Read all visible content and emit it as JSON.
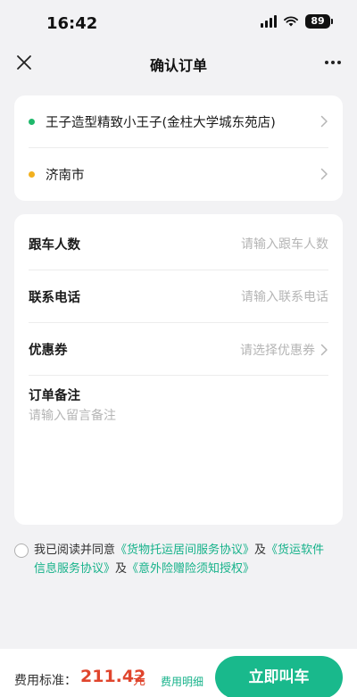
{
  "status_bar": {
    "time": "16:42",
    "battery": "89"
  },
  "nav": {
    "title": "确认订单"
  },
  "route": {
    "origin": {
      "name": "王子造型精致小王子(金柱大学城东苑店)",
      "color": "#1fb86b"
    },
    "destination": {
      "name": "济南市",
      "color": "#f2b01e"
    }
  },
  "form": {
    "passengers": {
      "label": "跟车人数",
      "placeholder": "请输入跟车人数"
    },
    "phone": {
      "label": "联系电话",
      "placeholder": "请输入联系电话"
    },
    "coupon": {
      "label": "优惠券",
      "placeholder": "请选择优惠券"
    },
    "note": {
      "label": "订单备注",
      "placeholder": "请输入留言备注"
    }
  },
  "agreement": {
    "prefix": "我已阅读并同意",
    "link1": "《货物托运居间服务协议》",
    "and1": "及",
    "link2": "《货运软件信息服务协议》",
    "and2": "及",
    "link3": "《意外险赠险须知授权》"
  },
  "footer": {
    "fee_label": "费用标准：",
    "fee_amount": "211.42",
    "fee_unit": "元",
    "fee_detail": "费用明细",
    "call_button": "立即叫车"
  },
  "colors": {
    "accent": "#19b98c",
    "price": "#e0452d",
    "link": "#16b28a"
  }
}
